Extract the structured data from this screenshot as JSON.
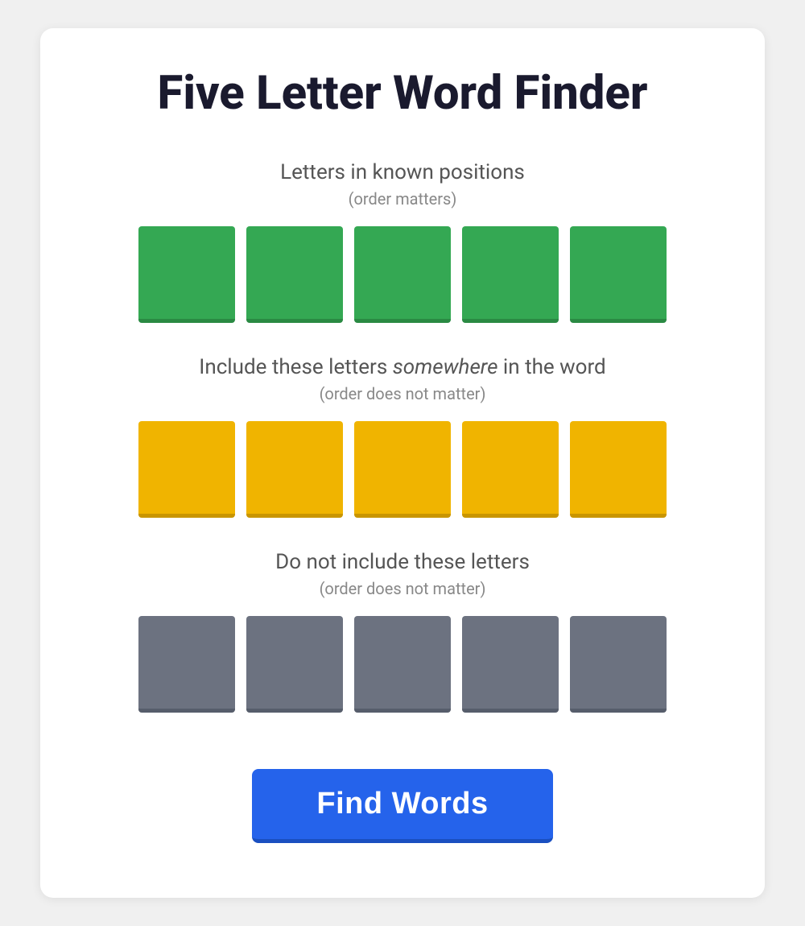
{
  "page": {
    "title": "Five Letter Word Finder",
    "card": {
      "section1": {
        "title": "Letters in known positions",
        "subtitle": "(order matters)",
        "tiles": [
          {
            "id": 1,
            "value": "",
            "color": "green"
          },
          {
            "id": 2,
            "value": "",
            "color": "green"
          },
          {
            "id": 3,
            "value": "",
            "color": "green"
          },
          {
            "id": 4,
            "value": "",
            "color": "green"
          },
          {
            "id": 5,
            "value": "",
            "color": "green"
          }
        ]
      },
      "section2": {
        "title_before": "Include these letters ",
        "title_em": "somewhere",
        "title_after": " in the word",
        "subtitle": "(order does not matter)",
        "tiles": [
          {
            "id": 1,
            "value": "",
            "color": "yellow"
          },
          {
            "id": 2,
            "value": "",
            "color": "yellow"
          },
          {
            "id": 3,
            "value": "",
            "color": "yellow"
          },
          {
            "id": 4,
            "value": "",
            "color": "yellow"
          },
          {
            "id": 5,
            "value": "",
            "color": "yellow"
          }
        ]
      },
      "section3": {
        "title": "Do not include these letters",
        "subtitle": "(order does not matter)",
        "tiles": [
          {
            "id": 1,
            "value": "",
            "color": "gray"
          },
          {
            "id": 2,
            "value": "",
            "color": "gray"
          },
          {
            "id": 3,
            "value": "",
            "color": "gray"
          },
          {
            "id": 4,
            "value": "",
            "color": "gray"
          },
          {
            "id": 5,
            "value": "",
            "color": "gray"
          }
        ]
      },
      "button": {
        "label": "Find Words"
      }
    }
  }
}
